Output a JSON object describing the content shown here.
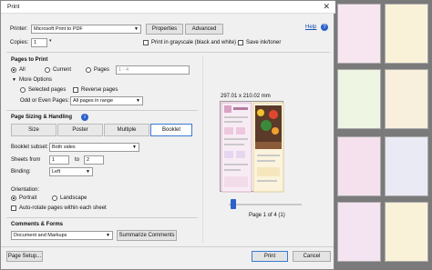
{
  "window": {
    "title": "Print",
    "help_label": "Help"
  },
  "printer": {
    "label": "Printer:",
    "value": "Microsoft Print to PDF",
    "properties_label": "Properties",
    "advanced_label": "Advanced",
    "copies_label": "Copies:",
    "copies_value": "1",
    "grayscale_label": "Print in grayscale (black and white)",
    "save_ink_label": "Save ink/toner"
  },
  "pages_to_print": {
    "title": "Pages to Print",
    "all_label": "All",
    "current_label": "Current",
    "pages_label": "Pages",
    "pages_value": "1 - 4",
    "more_options_label": "More Options",
    "selected_pages_label": "Selected pages",
    "reverse_pages_label": "Reverse pages",
    "odd_even_label": "Odd or Even Pages:",
    "odd_even_value": "All pages in range"
  },
  "sizing": {
    "title": "Page Sizing & Handling",
    "size_label": "Size",
    "poster_label": "Poster",
    "multiple_label": "Multiple",
    "booklet_label": "Booklet",
    "booklet_subset_label": "Booklet subset:",
    "booklet_subset_value": "Both sides",
    "sheets_from_label": "Sheets from",
    "sheets_from_value": "1",
    "sheets_to_label": "to",
    "sheets_to_value": "2",
    "binding_label": "Binding:",
    "binding_value": "Left"
  },
  "orientation": {
    "title": "Orientation:",
    "portrait_label": "Portrait",
    "landscape_label": "Landscape",
    "auto_rotate_label": "Auto-rotate pages within each sheet"
  },
  "comments": {
    "title": "Comments & Forms",
    "value": "Document and Markups",
    "summarize_label": "Summarize Comments"
  },
  "preview": {
    "size_text": "297.01 x 210.02 mm",
    "page_indicator": "Page 1 of 4 (1)",
    "slider_value": 0
  },
  "footer": {
    "page_setup_label": "Page Setup...",
    "print_label": "Print",
    "cancel_label": "Cancel"
  }
}
